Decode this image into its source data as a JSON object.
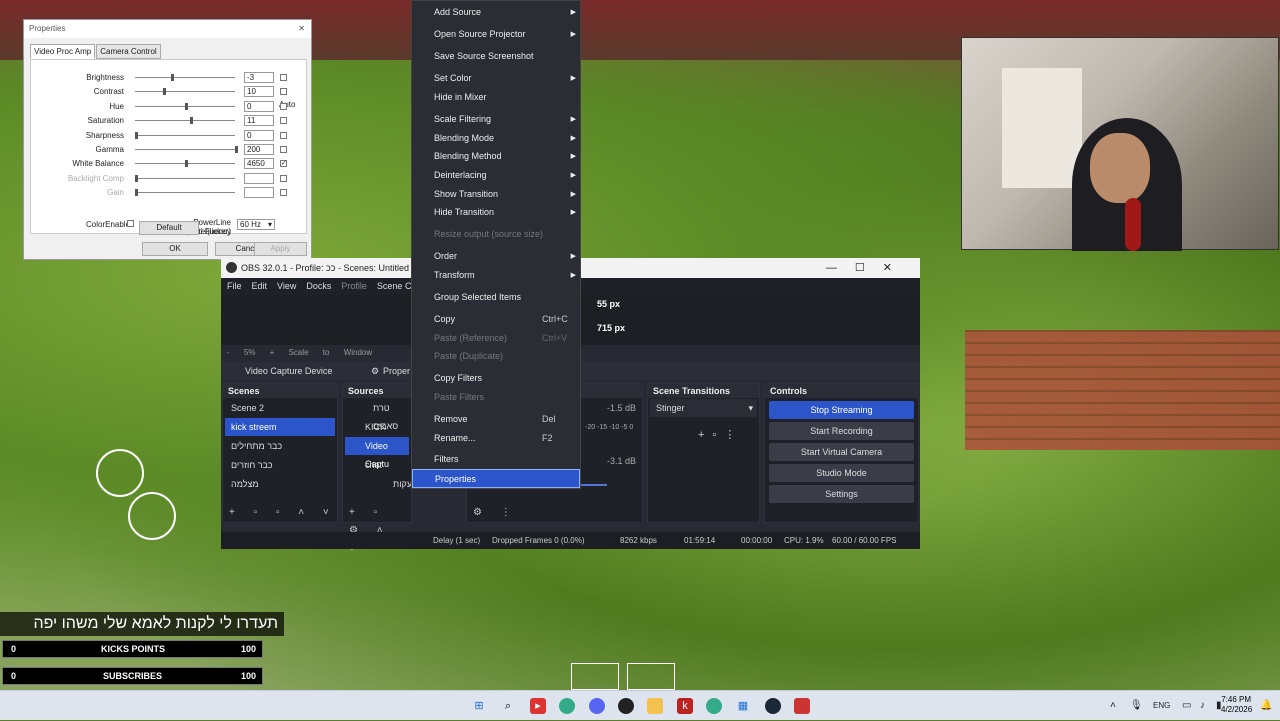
{
  "properties": {
    "title": "Properties",
    "tabs": [
      "Video Proc Amp",
      "Camera Control"
    ],
    "auto_label": "Auto",
    "rows": [
      {
        "label": "Brightness",
        "value": "-3",
        "checked": false
      },
      {
        "label": "Contrast",
        "value": "10",
        "checked": false
      },
      {
        "label": "Hue",
        "value": "0",
        "checked": false
      },
      {
        "label": "Saturation",
        "value": "11",
        "checked": false
      },
      {
        "label": "Sharpness",
        "value": "0",
        "checked": false
      },
      {
        "label": "Gamma",
        "value": "200",
        "checked": false
      },
      {
        "label": "White Balance",
        "value": "4650",
        "checked": true
      },
      {
        "label": "Backlight Comp",
        "value": "",
        "checked": false
      },
      {
        "label": "Gain",
        "value": "",
        "checked": false
      }
    ],
    "color_enable": "ColorEnable",
    "powerline_label": "PowerLine Frequency",
    "powerline_sub": "(Anti Flicker)",
    "powerline_value": "60 Hz",
    "default_btn": "Default",
    "ok_btn": "OK",
    "cancel_btn": "Cancel",
    "apply_btn": "Apply"
  },
  "obs": {
    "title": "OBS 32.0.1 - Profile: ככ - Scenes: Untitled",
    "menu": [
      "File",
      "Edit",
      "View",
      "Docks",
      "Profile",
      "Scene Co"
    ],
    "zoom": "-  5%  +  Scale to Window",
    "preview_text1": "55 px",
    "preview_text2": "715 px",
    "source_bar": "Video Capture Device",
    "source_bar_btn": "Proper",
    "scenes_header": "Scenes",
    "scenes": [
      "Scene 2",
      "kick streem",
      "כבר מתחילים",
      "כבר חוזרים",
      "מצלמה"
    ],
    "selected_scene": "kick streem",
    "sources_header": "Sources",
    "sources": [
      "טרת סאבים",
      "KICK GOAL",
      "Video Captu",
      "chat",
      "אזעקות"
    ],
    "mixer_db1": "-1.5 dB",
    "mixer_db2": "-3.1 dB",
    "mixer_scale": "-20 -15 -10 -5 0",
    "transitions_header": "Scene Transitions",
    "transition": "Stinger",
    "controls_header": "Controls",
    "controls": {
      "stop_streaming": "Stop Streaming",
      "start_recording": "Start Recording",
      "start_virtual_camera": "Start Virtual Camera",
      "studio_mode": "Studio Mode",
      "settings": "Settings"
    },
    "status": {
      "delay": "Delay (1 sec)",
      "dropped": "Dropped Frames 0 (0.0%)",
      "bitrate": "8262 kbps",
      "stream_time": "01:59:14",
      "rec_time": "00:00:00",
      "cpu": "CPU: 1.9%",
      "fps": "60.00 / 60.00 FPS"
    }
  },
  "context_menu": {
    "items": [
      {
        "label": "Add Source",
        "sub": true
      },
      {
        "label": "Open Source Projector",
        "sub": true
      },
      {
        "label": "Save Source Screenshot"
      },
      {
        "label": "Set Color",
        "sub": true
      },
      {
        "label": "Hide in Mixer"
      },
      {
        "label": "Scale Filtering",
        "sub": true
      },
      {
        "label": "Blending Mode",
        "sub": true
      },
      {
        "label": "Blending Method",
        "sub": true
      },
      {
        "label": "Deinterlacing",
        "sub": true
      },
      {
        "label": "Show Transition",
        "sub": true
      },
      {
        "label": "Hide Transition",
        "sub": true
      },
      {
        "label": "Resize output (source size)",
        "disabled": true
      },
      {
        "label": "Order",
        "sub": true
      },
      {
        "label": "Transform",
        "sub": true
      },
      {
        "label": "Group Selected Items"
      },
      {
        "label": "Copy",
        "shortcut": "Ctrl+C"
      },
      {
        "label": "Paste (Reference)",
        "shortcut": "Ctrl+V",
        "disabled": true
      },
      {
        "label": "Paste (Duplicate)",
        "disabled": true
      },
      {
        "label": "Copy Filters"
      },
      {
        "label": "Paste Filters",
        "disabled": true
      },
      {
        "label": "Remove",
        "shortcut": "Del"
      },
      {
        "label": "Rename...",
        "shortcut": "F2"
      },
      {
        "label": "Filters"
      },
      {
        "label": "Properties",
        "highlight": true
      }
    ]
  },
  "overlay": {
    "hebrew": "תעדרו לי לקנות לאמא שלי משהו יפה",
    "kicks_left": "0",
    "kicks_label": "KICKS POINTS",
    "kicks_right": "100",
    "subs_left": "0",
    "subs_label": "SUBSCRIBES",
    "subs_right": "100"
  },
  "taskbar": {
    "lang": "ENG",
    "time": "7:46 PM",
    "date": "4/2/2026"
  }
}
